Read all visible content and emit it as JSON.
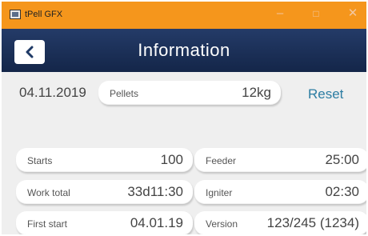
{
  "window": {
    "title": "tPell GFX",
    "minimize_glyph": "–",
    "maximize_glyph": "□",
    "close_glyph": "✕"
  },
  "header": {
    "title": "Information",
    "back_icon": "chevron-left-icon"
  },
  "summary": {
    "date": "04.11.2019",
    "pellets_label": "Pellets",
    "pellets_value": "12kg",
    "reset_label": "Reset"
  },
  "stats": {
    "starts_label": "Starts",
    "starts_value": "100",
    "feeder_label": "Feeder",
    "feeder_value": "25:00",
    "work_total_label": "Work total",
    "work_total_value": "33d11:30",
    "igniter_label": "Igniter",
    "igniter_value": "02:30",
    "first_start_label": "First start",
    "first_start_value": "04.01.19",
    "version_label": "Version",
    "version_value": "123/245 (1234)"
  },
  "colors": {
    "titlebar": "#f5961c",
    "header": "#1c3159",
    "accent": "#2c7da3",
    "background": "#efefef"
  }
}
